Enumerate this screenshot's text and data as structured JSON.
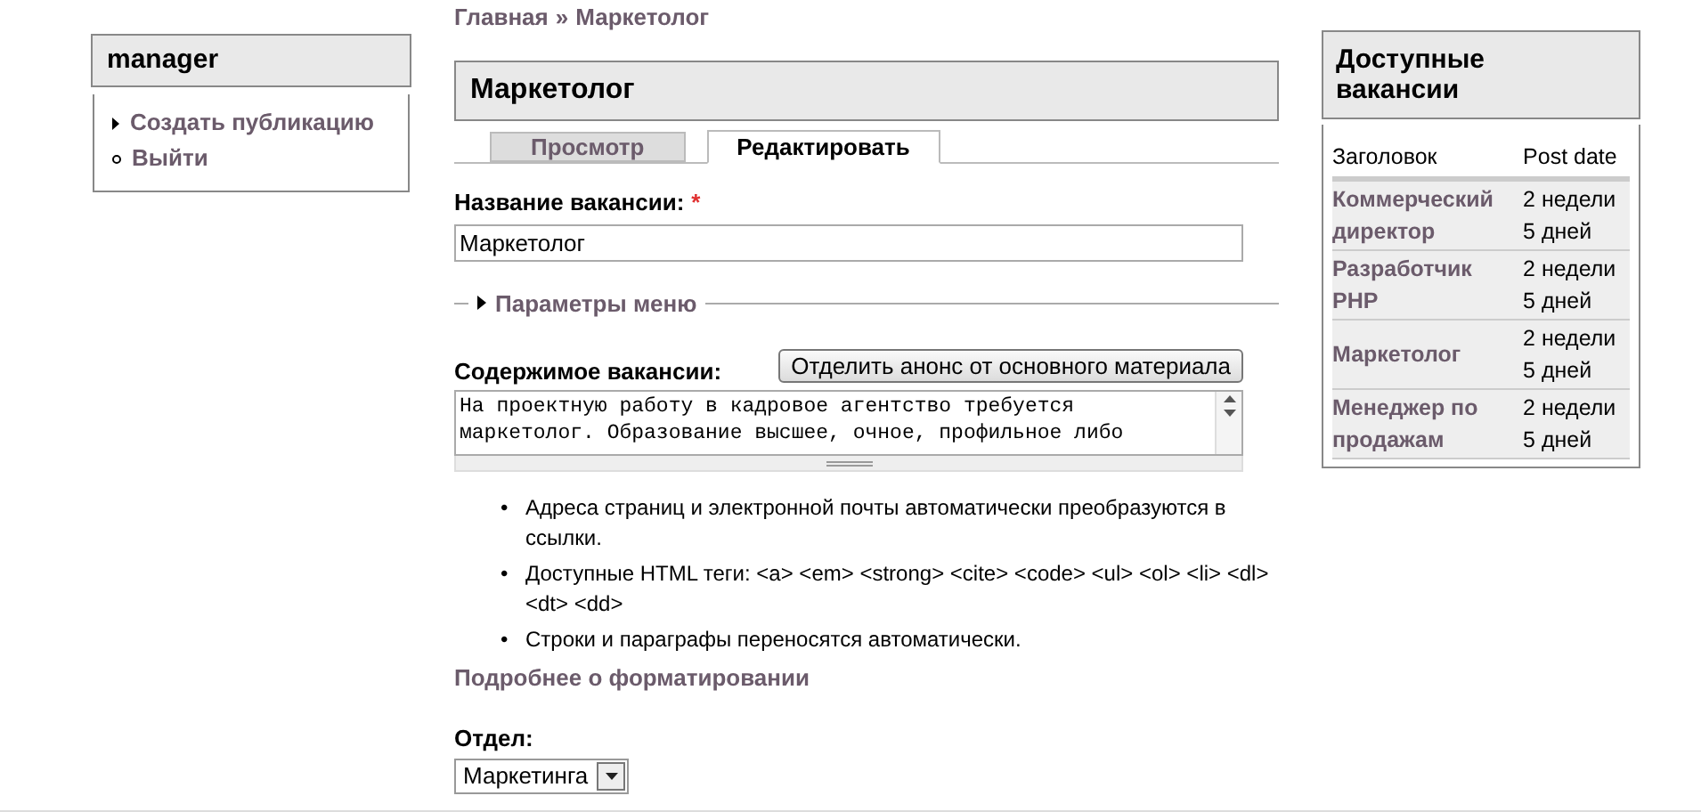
{
  "user_block": {
    "title": "manager",
    "items": [
      {
        "label": "Создать публикацию",
        "kind": "collapsed"
      },
      {
        "label": "Выйти",
        "kind": "leaf"
      }
    ]
  },
  "breadcrumb": [
    {
      "label": "Главная"
    },
    {
      "label": "Маркетолог"
    }
  ],
  "breadcrumb_separator": "»",
  "page_title": "Маркетолог",
  "tabs": [
    {
      "label": "Просмотр",
      "selected": false
    },
    {
      "label": "Редактировать",
      "selected": true
    }
  ],
  "title_field": {
    "label": "Название вакансии:",
    "required_mark": "*",
    "value": "Маркетолог"
  },
  "menu_fieldset": {
    "legend": "Параметры меню",
    "expanded": false
  },
  "body_field": {
    "label": "Содержимое вакансии:",
    "split_button": "Отделить анонс от основного материала",
    "value": "На проектную работу в кадровое агентство требуется\nмаркетолог. Образование высшее, очное, профильное либо"
  },
  "format_tips": [
    "Адреса страниц и электронной почты автоматически преобразуются в ссылки.",
    "Доступные HTML теги: <a> <em> <strong> <cite> <code> <ul> <ol> <li> <dl> <dt> <dd>",
    "Строки и параграфы переносятся автоматически."
  ],
  "tip_bullet": "•",
  "format_link": "Подробнее о форматировании",
  "department": {
    "label": "Отдел:",
    "value": "Маркетинга"
  },
  "vacancies": {
    "title": "Доступные вакансии",
    "columns": [
      "Заголовок",
      "Post date"
    ],
    "rows": [
      {
        "title": "Коммерческий директор",
        "date": "2 недели 5 дней"
      },
      {
        "title": "Разработчик PHP",
        "date": "2 недели 5 дней"
      },
      {
        "title": "Маркетолог",
        "date": "2 недели 5 дней"
      },
      {
        "title": "Менеджер по продажам",
        "date": "2 недели 5 дней"
      }
    ]
  }
}
